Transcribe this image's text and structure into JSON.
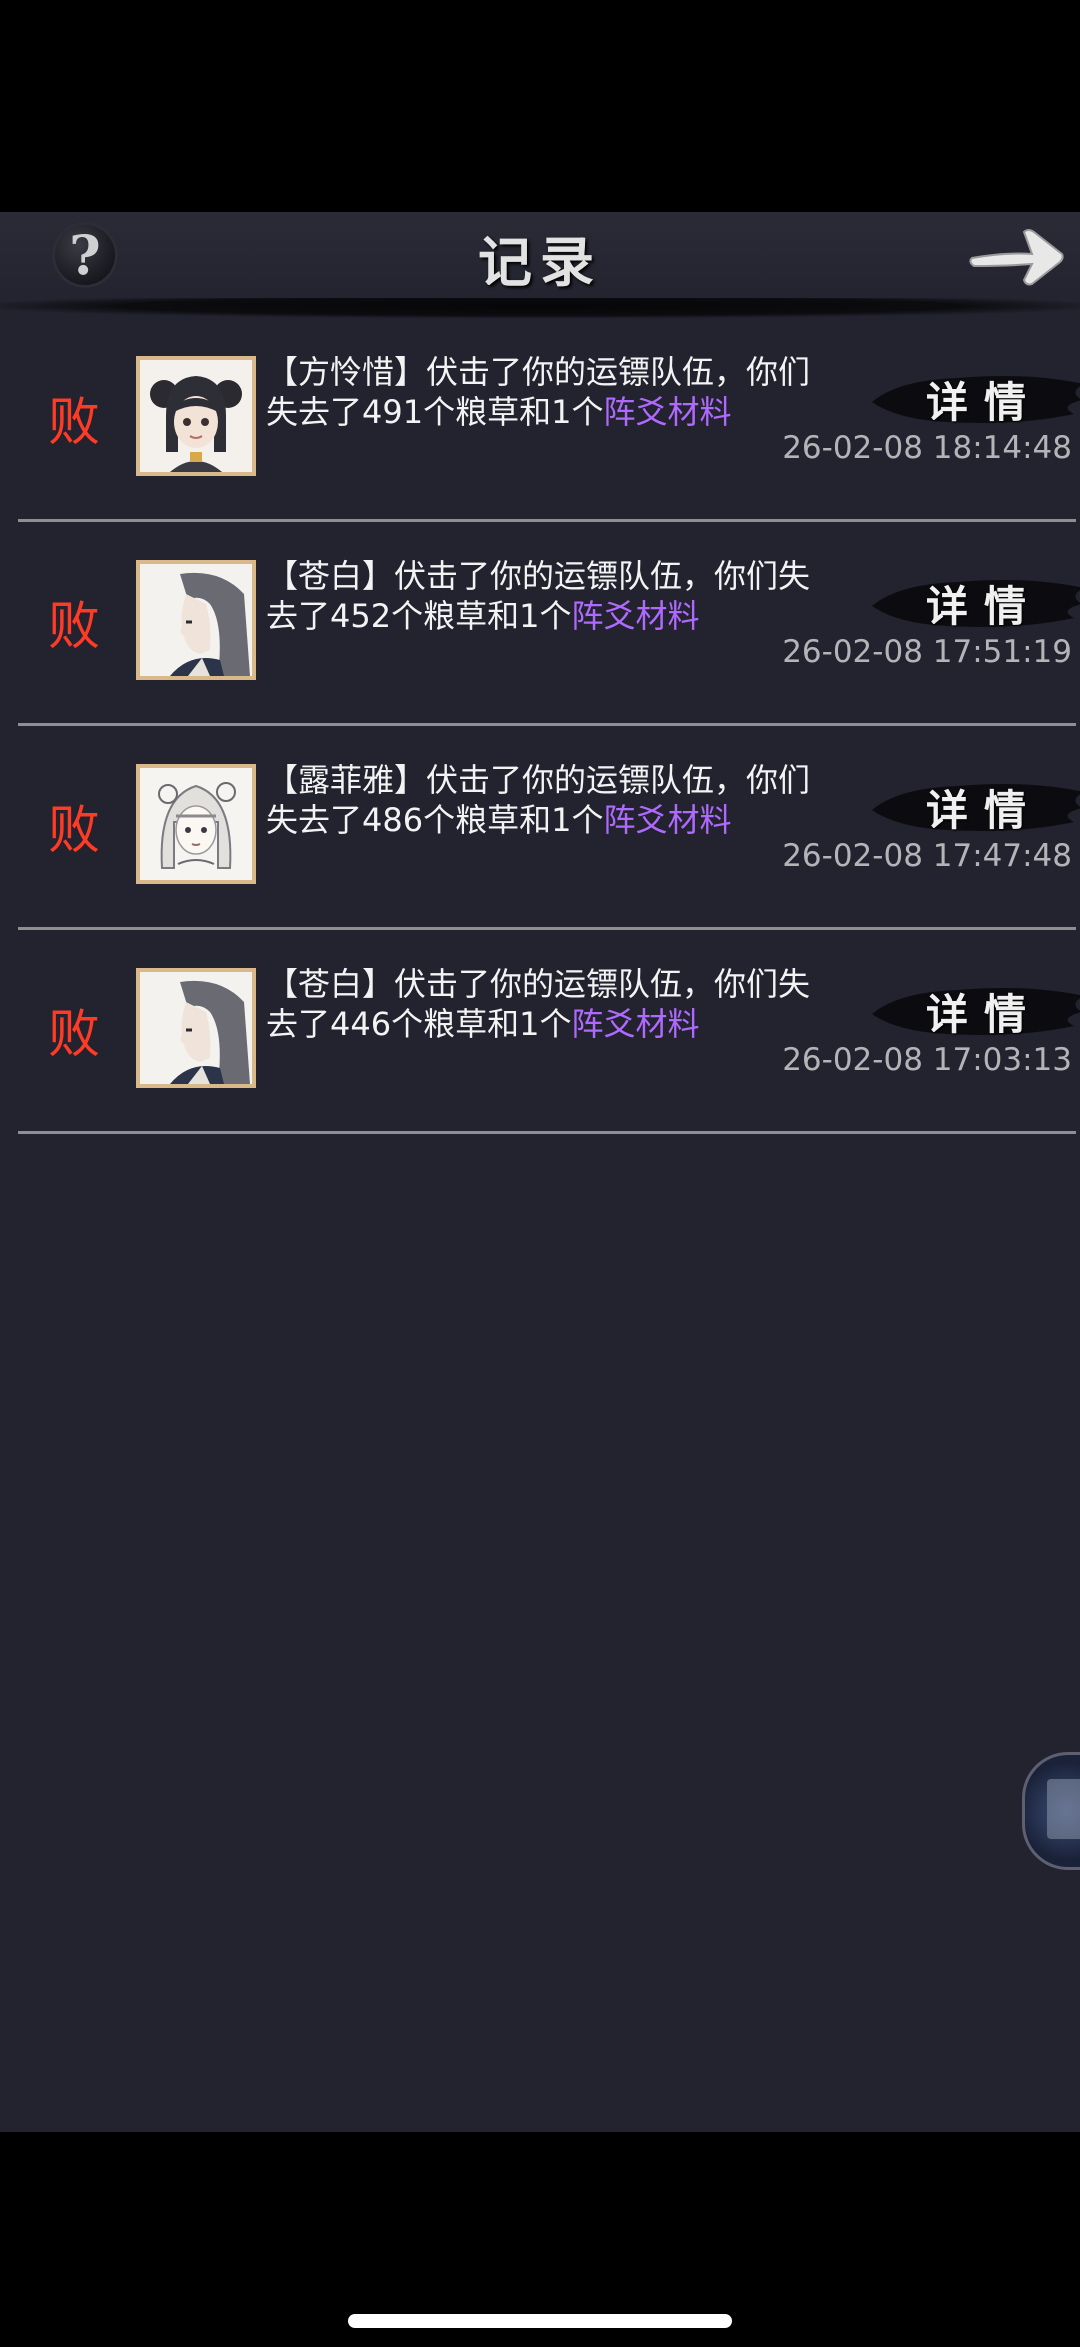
{
  "header": {
    "title": "记录",
    "help_label": "?"
  },
  "colors": {
    "defeat": "#ff3b26",
    "item_highlight": "#b069ff",
    "avatar_border": "#d9b98a"
  },
  "records": [
    {
      "result": "败",
      "avatar_icon": "female-hair-buns-avatar-icon",
      "msg_text": "【方怜惜】伏击了你的运镖队伍，你们失去了491个粮草和1个",
      "item_text": "阵爻材料",
      "detail_label": "详情",
      "time": "26-02-08 18:14:48"
    },
    {
      "result": "败",
      "avatar_icon": "male-long-hair-avatar-icon",
      "msg_text": "【苍白】伏击了你的运镖队伍，你们失去了452个粮草和1个",
      "item_text": "阵爻材料",
      "detail_label": "详情",
      "time": "26-02-08 17:51:19"
    },
    {
      "result": "败",
      "avatar_icon": "female-ornament-hair-avatar-icon",
      "msg_text": "【露菲雅】伏击了你的运镖队伍，你们失去了486个粮草和1个",
      "item_text": "阵爻材料",
      "detail_label": "详情",
      "time": "26-02-08 17:47:48"
    },
    {
      "result": "败",
      "avatar_icon": "male-long-hair-avatar-icon",
      "msg_text": "【苍白】伏击了你的运镖队伍，你们失去了446个粮草和1个",
      "item_text": "阵爻材料",
      "detail_label": "详情",
      "time": "26-02-08 17:03:13"
    }
  ]
}
